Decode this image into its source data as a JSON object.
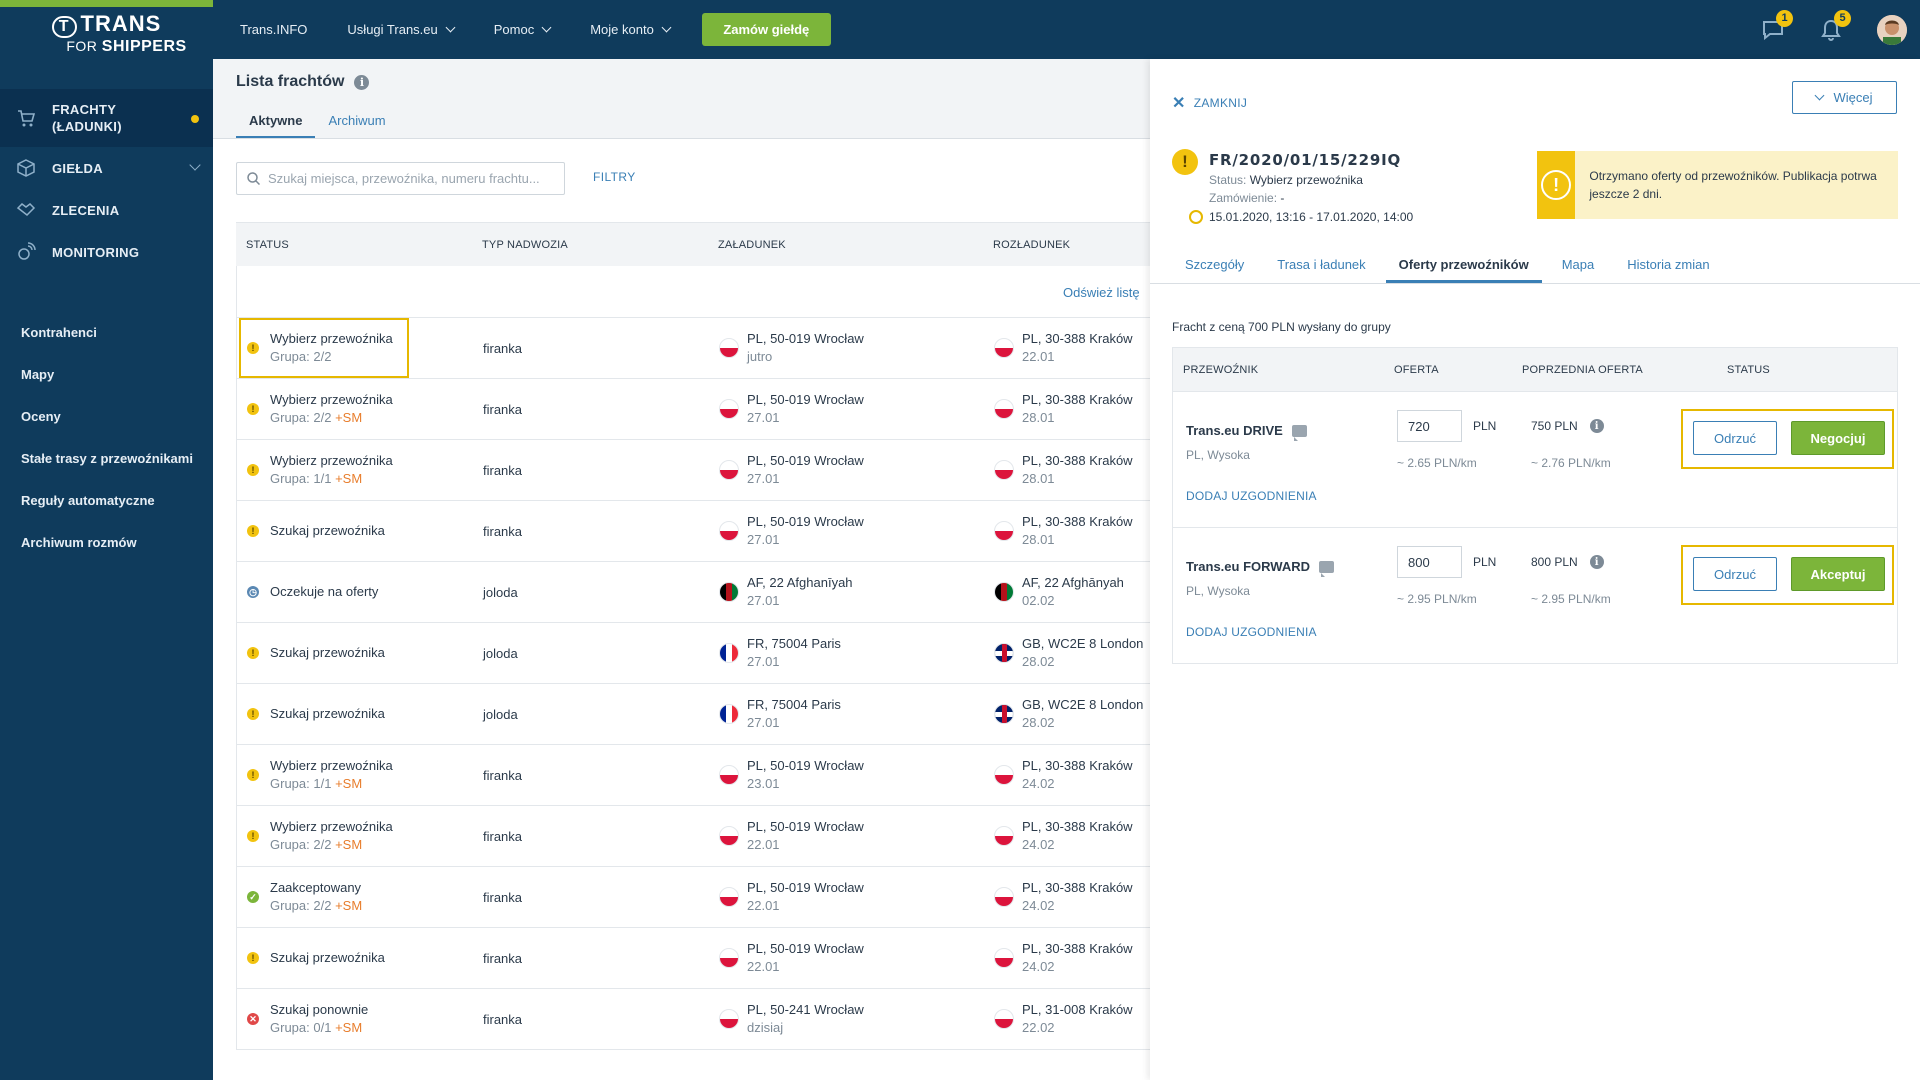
{
  "brand": {
    "logo_main": "TRANS",
    "logo_mark": "T",
    "logo_for": "FOR",
    "logo_sub": "SHIPPERS"
  },
  "sidebar": {
    "main": [
      {
        "label": "FRACHTY (ŁADUNKI)",
        "icon": "cart-icon",
        "active": true,
        "dot": true
      },
      {
        "label": "GIEŁDA",
        "icon": "box-icon"
      },
      {
        "label": "ZLECENIA",
        "icon": "handshake-icon"
      },
      {
        "label": "MONITORING",
        "icon": "satellite-icon"
      }
    ],
    "secondary": [
      "Kontrahenci",
      "Mapy",
      "Oceny",
      "Stałe trasy z przewoźnikami",
      "Reguły automatyczne",
      "Archiwum rozmów"
    ]
  },
  "topbar": {
    "nav": [
      "Trans.INFO",
      "Usługi Trans.eu",
      "Pomoc",
      "Moje konto"
    ],
    "order_button": "Zamów giełdę",
    "messages_badge": "1",
    "notifications_badge": "5"
  },
  "list": {
    "title": "Lista frachtów",
    "tabs": [
      "Aktywne",
      "Archiwum"
    ],
    "search_placeholder": "Szukaj miejsca, przewoźnika, numeru frachtu...",
    "filters": "FILTRY",
    "headers": [
      "STATUS",
      "TYP NADWOZIA",
      "ZAŁADUNEK",
      "ROZŁADUNEK"
    ],
    "refresh": "Odśwież listę",
    "rows": [
      {
        "icon": "warn",
        "status": "Wybierz przewoźnika",
        "group": "Grupa: 2/2",
        "sm": "",
        "body": "firanka",
        "lflag": "pl",
        "load": "PL, 50-019 Wrocław",
        "ldate": "jutro",
        "uflag": "pl",
        "unload": "PL, 30-388 Kraków",
        "udate": "22.01",
        "hl": true
      },
      {
        "icon": "warn",
        "status": "Wybierz przewoźnika",
        "group": "Grupa: 2/2",
        "sm": "+SM",
        "body": "firanka",
        "lflag": "pl",
        "load": "PL, 50-019 Wrocław",
        "ldate": "27.01",
        "uflag": "pl",
        "unload": "PL, 30-388 Kraków",
        "udate": "28.01"
      },
      {
        "icon": "warn",
        "status": "Wybierz przewoźnika",
        "group": "Grupa: 1/1",
        "sm": "+SM",
        "body": "firanka",
        "lflag": "pl",
        "load": "PL, 50-019 Wrocław",
        "ldate": "27.01",
        "uflag": "pl",
        "unload": "PL, 30-388 Kraków",
        "udate": "28.01"
      },
      {
        "icon": "warn",
        "status": "Szukaj przewoźnika",
        "group": "",
        "sm": "",
        "body": "firanka",
        "lflag": "pl",
        "load": "PL, 50-019 Wrocław",
        "ldate": "27.01",
        "uflag": "pl",
        "unload": "PL, 30-388 Kraków",
        "udate": "28.01"
      },
      {
        "icon": "clock",
        "status": "Oczekuje na oferty",
        "group": "",
        "sm": "",
        "body": "joloda",
        "lflag": "af",
        "load": "AF, 22 Afghanīyah",
        "ldate": "27.01",
        "uflag": "af",
        "unload": "AF, 22 Afghānyah",
        "udate": "02.02"
      },
      {
        "icon": "warn",
        "status": "Szukaj przewoźnika",
        "group": "",
        "sm": "",
        "body": "joloda",
        "lflag": "fr",
        "load": "FR, 75004 Paris",
        "ldate": "27.01",
        "uflag": "gb",
        "unload": "GB, WC2E 8 London",
        "udate": "28.02"
      },
      {
        "icon": "warn",
        "status": "Szukaj przewoźnika",
        "group": "",
        "sm": "",
        "body": "joloda",
        "lflag": "fr",
        "load": "FR, 75004 Paris",
        "ldate": "27.01",
        "uflag": "gb",
        "unload": "GB, WC2E 8 London",
        "udate": "28.02"
      },
      {
        "icon": "warn",
        "status": "Wybierz przewoźnika",
        "group": "Grupa: 1/1",
        "sm": "+SM",
        "body": "firanka",
        "lflag": "pl",
        "load": "PL, 50-019 Wrocław",
        "ldate": "23.01",
        "uflag": "pl",
        "unload": "PL, 30-388 Kraków",
        "udate": "24.02"
      },
      {
        "icon": "warn",
        "status": "Wybierz przewoźnika",
        "group": "Grupa: 2/2",
        "sm": "+SM",
        "body": "firanka",
        "lflag": "pl",
        "load": "PL, 50-019 Wrocław",
        "ldate": "22.01",
        "uflag": "pl",
        "unload": "PL, 30-388 Kraków",
        "udate": "24.02"
      },
      {
        "icon": "ok",
        "status": "Zaakceptowany",
        "group": "Grupa: 2/2",
        "sm": "+SM",
        "body": "firanka",
        "lflag": "pl",
        "load": "PL, 50-019 Wrocław",
        "ldate": "22.01",
        "uflag": "pl",
        "unload": "PL, 30-388 Kraków",
        "udate": "24.02"
      },
      {
        "icon": "warn",
        "status": "Szukaj przewoźnika",
        "group": "",
        "sm": "",
        "body": "firanka",
        "lflag": "pl",
        "load": "PL, 50-019 Wrocław",
        "ldate": "22.01",
        "uflag": "pl",
        "unload": "PL, 30-388 Kraków",
        "udate": "24.02"
      },
      {
        "icon": "err",
        "status": "Szukaj ponownie",
        "group": "Grupa: 0/1",
        "sm": "+SM",
        "body": "firanka",
        "lflag": "pl",
        "load": "PL, 50-241 Wrocław",
        "ldate": "dzisiaj",
        "uflag": "pl",
        "unload": "PL, 31-008 Kraków",
        "udate": "22.02"
      }
    ]
  },
  "panel": {
    "close": "ZAMKNIJ",
    "more": "Więcej",
    "freight_id": "FR/2020/01/15/229IQ",
    "status_label": "Status:",
    "status_value": "Wybierz przewoźnika",
    "order_label": "Zamówienie:",
    "order_value": "-",
    "dates": "15.01.2020, 13:16 - 17.01.2020, 14:00",
    "notice": "Otrzymano oferty od przewoźników. Publikacja potrwa jeszcze 2 dni.",
    "tabs": [
      "Szczegóły",
      "Trasa i ładunek",
      "Oferty przewoźników",
      "Mapa",
      "Historia zmian"
    ],
    "active_tab": 2,
    "sent_info": "Fracht z ceną 700 PLN wysłany do grupy",
    "offer_headers": [
      "PRZEWOŹNIK",
      "OFERTA",
      "POPRZEDNIA OFERTA",
      "STATUS"
    ],
    "offers": [
      {
        "carrier": "Trans.eu DRIVE",
        "location": "PL, Wysoka",
        "add": "DODAJ UZGODNIENIA",
        "offer": "720",
        "currency": "PLN",
        "per_km": "~ 2.65 PLN/km",
        "prev": "750  PLN",
        "prev_km": "~ 2.76 PLN/km",
        "reject": "Odrzuć",
        "action": "Negocjuj"
      },
      {
        "carrier": "Trans.eu FORWARD",
        "location": "PL, Wysoka",
        "add": "DODAJ UZGODNIENIA",
        "offer": "800",
        "currency": "PLN",
        "per_km": "~ 2.95 PLN/km",
        "prev": "800  PLN",
        "prev_km": "~ 2.95 PLN/km",
        "reject": "Odrzuć",
        "action": "Akceptuj"
      }
    ]
  }
}
